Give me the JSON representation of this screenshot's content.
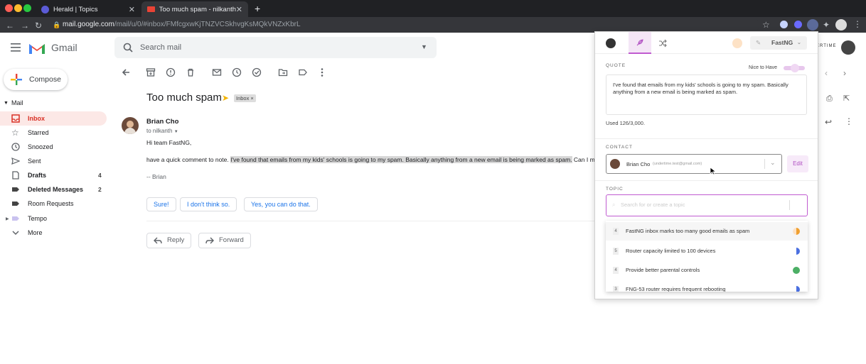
{
  "browser": {
    "tabs": [
      {
        "title": "Herald | Topics",
        "active": false
      },
      {
        "title": "Too much spam - nilkanth@un",
        "active": true
      }
    ],
    "url_host": "mail.google.com",
    "url_path": "/mail/u/0/#inbox/FMfcgxwKjTNZVCSkhvgKsMQkVNZxKbrL"
  },
  "gmail": {
    "app_name": "Gmail",
    "search_placeholder": "Search mail",
    "compose_label": "Compose",
    "section_label": "Mail",
    "nav": [
      {
        "label": "Inbox",
        "count": "",
        "icon": "inbox-icon"
      },
      {
        "label": "Starred",
        "count": "",
        "icon": "star-icon"
      },
      {
        "label": "Snoozed",
        "count": "",
        "icon": "clock-icon"
      },
      {
        "label": "Sent",
        "count": "",
        "icon": "send-icon"
      },
      {
        "label": "Drafts",
        "count": "4",
        "icon": "draft-icon"
      },
      {
        "label": "Deleted Messages",
        "count": "2",
        "icon": "label-icon"
      },
      {
        "label": "Room Requests",
        "count": "",
        "icon": "label-icon"
      },
      {
        "label": "Tempo",
        "count": "",
        "icon": "label-icon"
      },
      {
        "label": "More",
        "count": "",
        "icon": "chevron-down-icon"
      }
    ],
    "header_right_text": "ERTIME"
  },
  "message": {
    "subject": "Too much spam",
    "label_chip": "Inbox ×",
    "sender": "Brian Cho",
    "to": "to nilkanth",
    "greeting": "Hi team FastNG,",
    "body_prefix": "have a quick comment to note.",
    "body_highlight": "I've found that emails from my kids' schools is going to my spam. Basically anything from a new email is being marked as spam.",
    "body_suffix": "Can I make th",
    "signature": "-- Brian",
    "smart_replies": [
      "Sure!",
      "I don't think so.",
      "Yes, you can do that."
    ],
    "reply_label": "Reply",
    "forward_label": "Forward"
  },
  "panel": {
    "brand": "FastNG",
    "quote_label": "QUOTE",
    "priority_label": "Nice to Have",
    "quote_text": "I've found that emails from my kids' schools is going to my spam. Basically anything from a new email is being marked as spam.",
    "usage": "Used 126/3,000.",
    "contact_label": "CONTACT",
    "contact_name": "Brian Cho",
    "contact_email": "(undertime.test@gmail.com)",
    "edit_label": "Edit",
    "topic_label": "TOPIC",
    "topic_placeholder": "Search for or create a topic",
    "topics": [
      {
        "num": "4",
        "title": "FastNG inbox marks too many good emails as spam",
        "color": "#f0a030"
      },
      {
        "num": "5",
        "title": "Router capacity limited to 100 devices",
        "color": "#4a6fe0"
      },
      {
        "num": "4",
        "title": "Provide better parental controls",
        "color": "#4caf65"
      },
      {
        "num": "3",
        "title": "FNG-53 router requires frequent rebooting",
        "color": "#4a6fe0"
      }
    ],
    "accent": "#c05bd0"
  }
}
